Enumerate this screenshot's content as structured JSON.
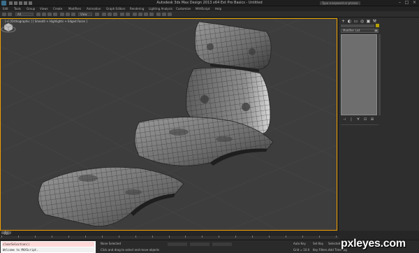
{
  "window": {
    "title": "Autodesk 3ds Max Design 2013 x64    Ext Pro Basics - Untitled",
    "search_placeholder": "Type a keyword or phrase"
  },
  "menu": {
    "items": [
      "Edit",
      "Tools",
      "Group",
      "Views",
      "Create",
      "Modifiers",
      "Animation",
      "Graph Editors",
      "Rendering",
      "Lighting Analysis",
      "Customize",
      "MAXScript",
      "Help"
    ]
  },
  "toolbar": {
    "selection_filter": "All",
    "view_dropdown": "View"
  },
  "viewport": {
    "label": "[+] [Orthographic ] [ Smooth + Highlights + Edged Faces ]",
    "border_color": "#f0a000",
    "background": "#3d3d3d"
  },
  "command_panel": {
    "tabs": [
      "+",
      "◐",
      "▭",
      "◎",
      "▣",
      "⚒"
    ],
    "modifier_list": "Modifier List",
    "stack_buttons": [
      "⊣",
      "|",
      "∀",
      "⊡",
      "⊞"
    ]
  },
  "timeline": {
    "position": "0 / 100",
    "ticks": [
      "0",
      "5",
      "10",
      "15",
      "20",
      "25",
      "30",
      "35",
      "40",
      "45",
      "50",
      "55",
      "60",
      "65",
      "70",
      "75",
      "80",
      "85",
      "90",
      "95",
      "100"
    ]
  },
  "statusbar": {
    "maxscript_line1": "clearSelection()",
    "maxscript_line2": "Welcome to MAXScript.",
    "status_primary": "None Selected",
    "status_prompt": "Click and drag to select and move objects",
    "grid": "Grid = 10.0",
    "autokey": "Auto Key",
    "set_key": "Set Key",
    "key_filters": "Key Filters...",
    "selected": "Selected",
    "add_time_tag": "Add Time Tag"
  },
  "watermark": {
    "text": "pxleyes.com"
  }
}
